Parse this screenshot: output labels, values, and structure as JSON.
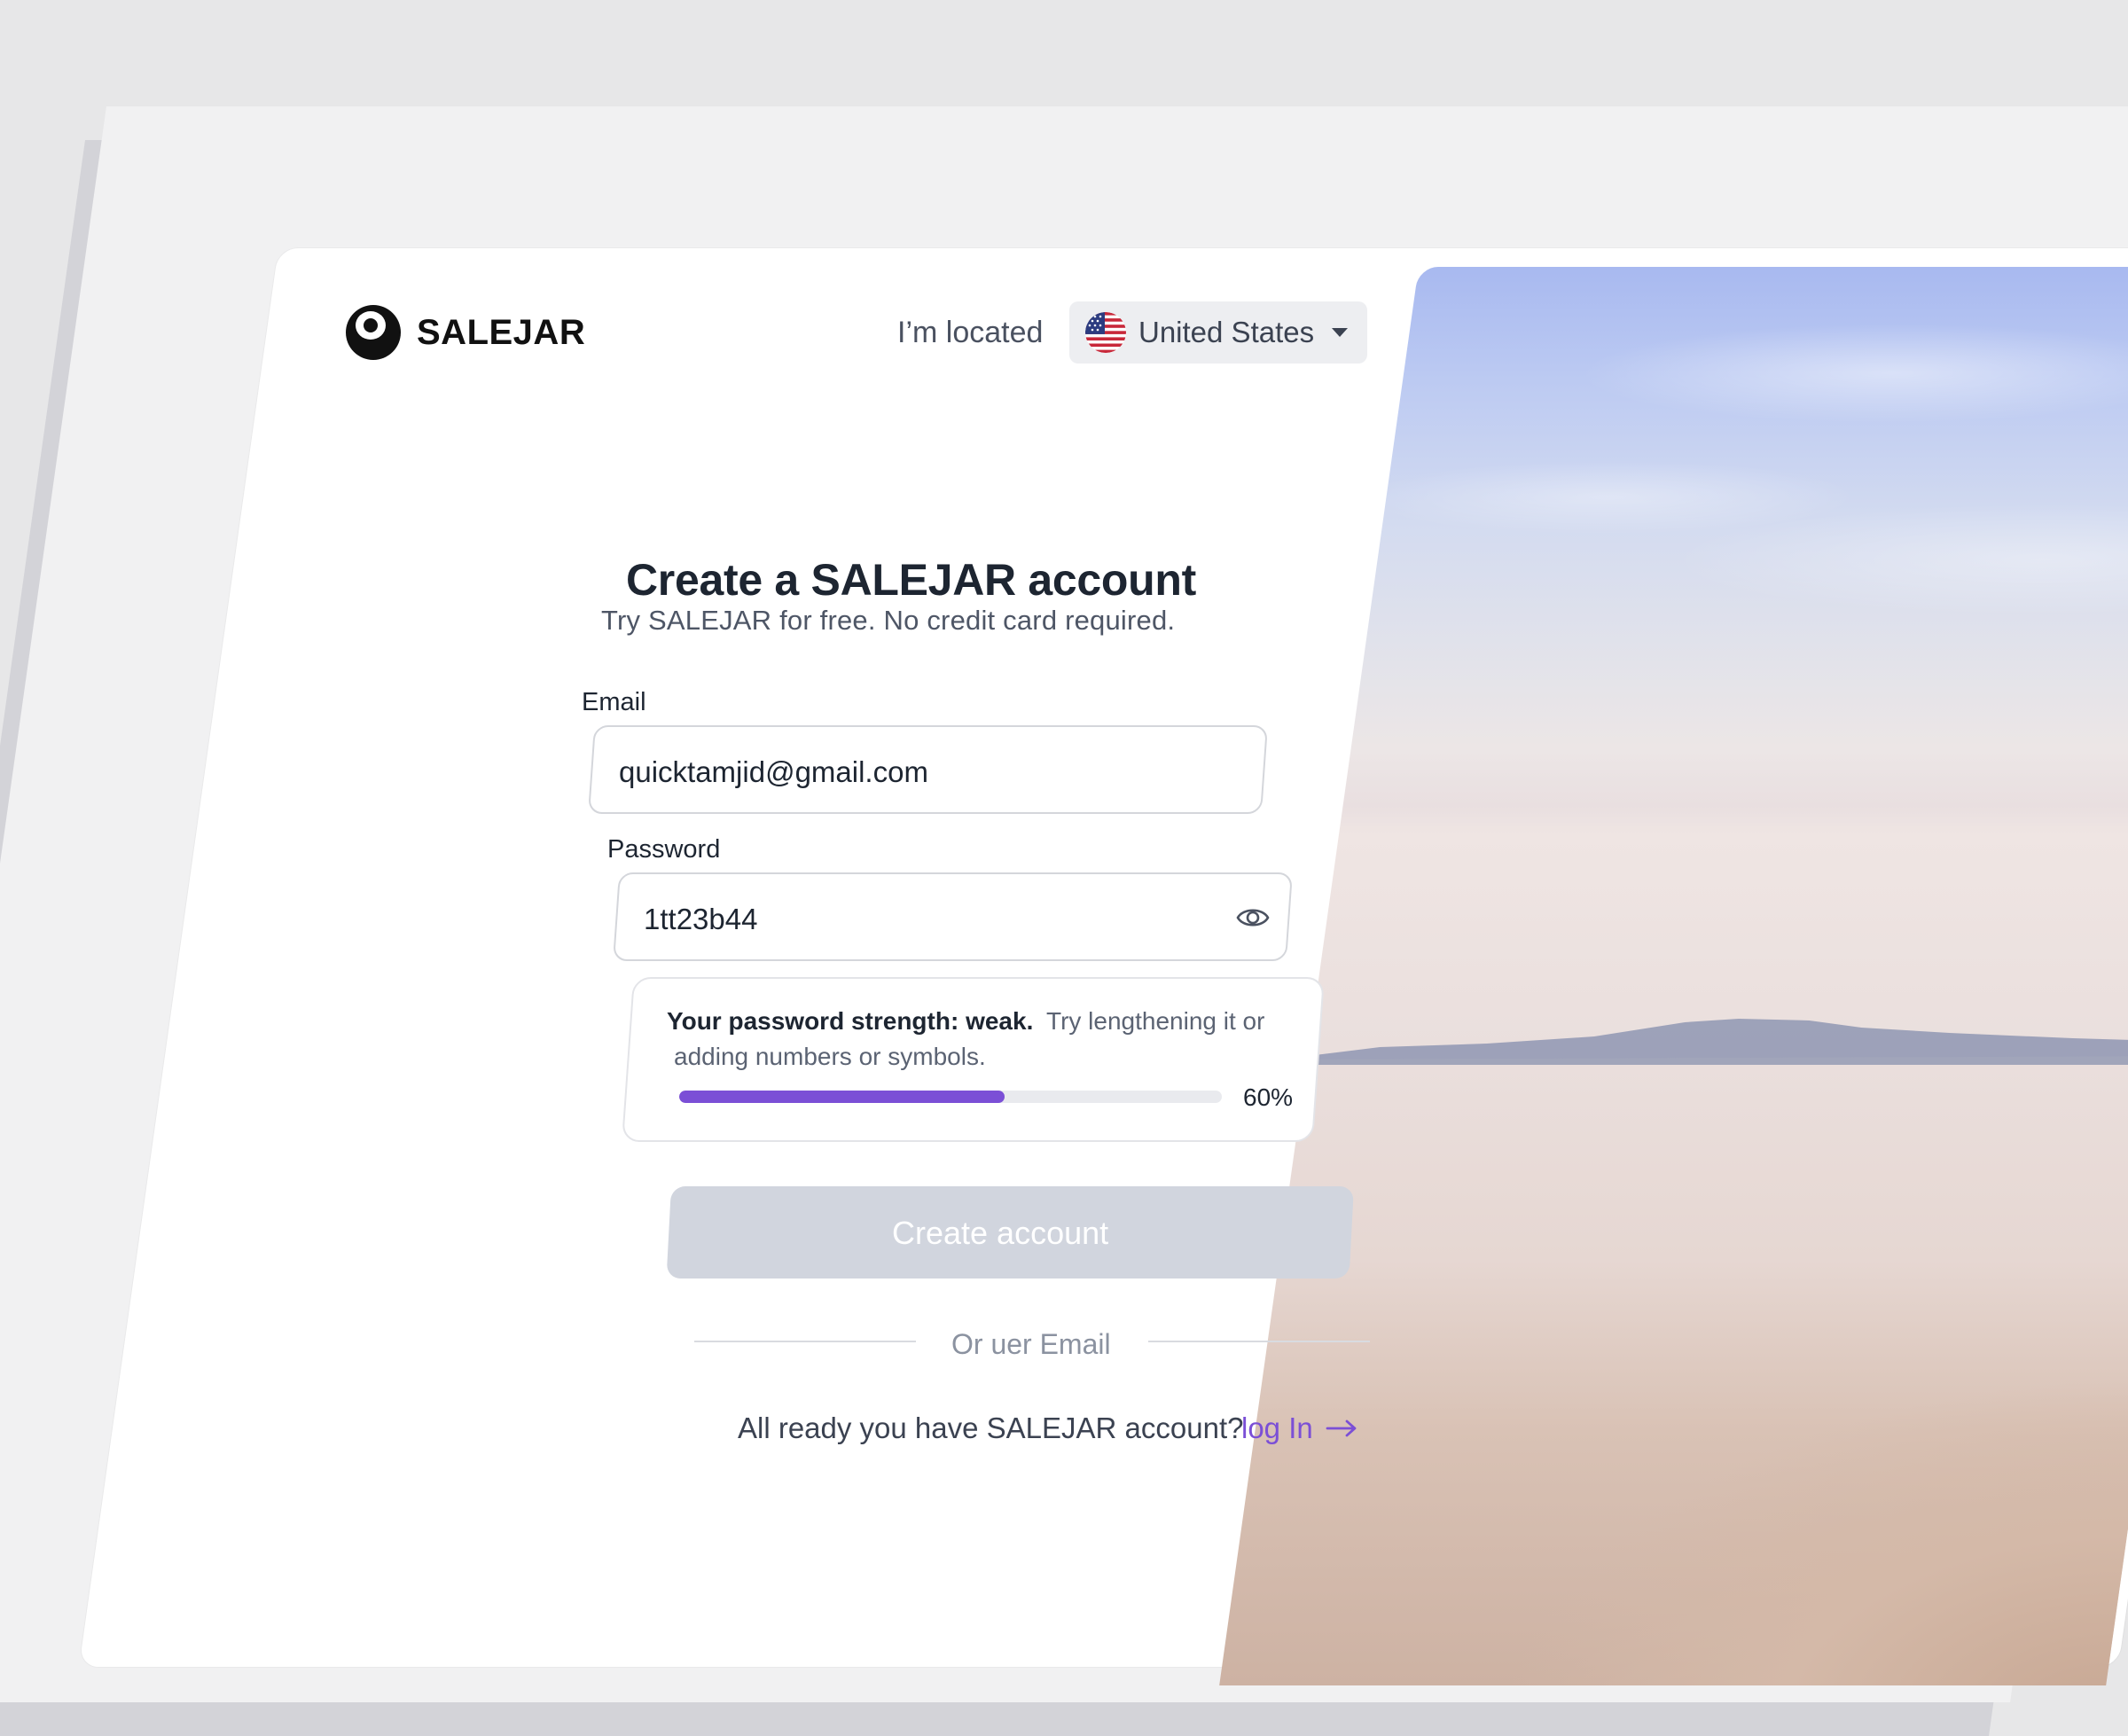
{
  "brand": {
    "name": "SALEJAR"
  },
  "header": {
    "located_label": "I’m located",
    "country": "United States"
  },
  "form": {
    "title": "Create a SALEJAR account",
    "subtitle": "Try SALEJAR for free. No credit card required.",
    "email_label": "Email",
    "email_value": "quicktamjid@gmail.com",
    "password_label": "Password",
    "password_value": "1tt23b44",
    "strength": {
      "title": "Your password strength: weak.",
      "hint_line1": "Try lengthening it or",
      "hint_line2": "adding numbers or symbols.",
      "percent_label": "60%",
      "percent_value": 60,
      "bar_color": "#7b4fd6"
    },
    "submit_label": "Create account",
    "submit_color": "#d1d5de",
    "divider_label": "Or uer Email",
    "login_question": "All ready you have SALEJAR account?",
    "login_link": "log In",
    "link_color": "#7b4fd6"
  },
  "icons": {
    "logo": "salejar-logo-icon",
    "flag": "us-flag-icon",
    "dropdown": "caret-down-icon",
    "password_toggle": "eye-icon",
    "login_arrow": "arrow-right-icon"
  }
}
